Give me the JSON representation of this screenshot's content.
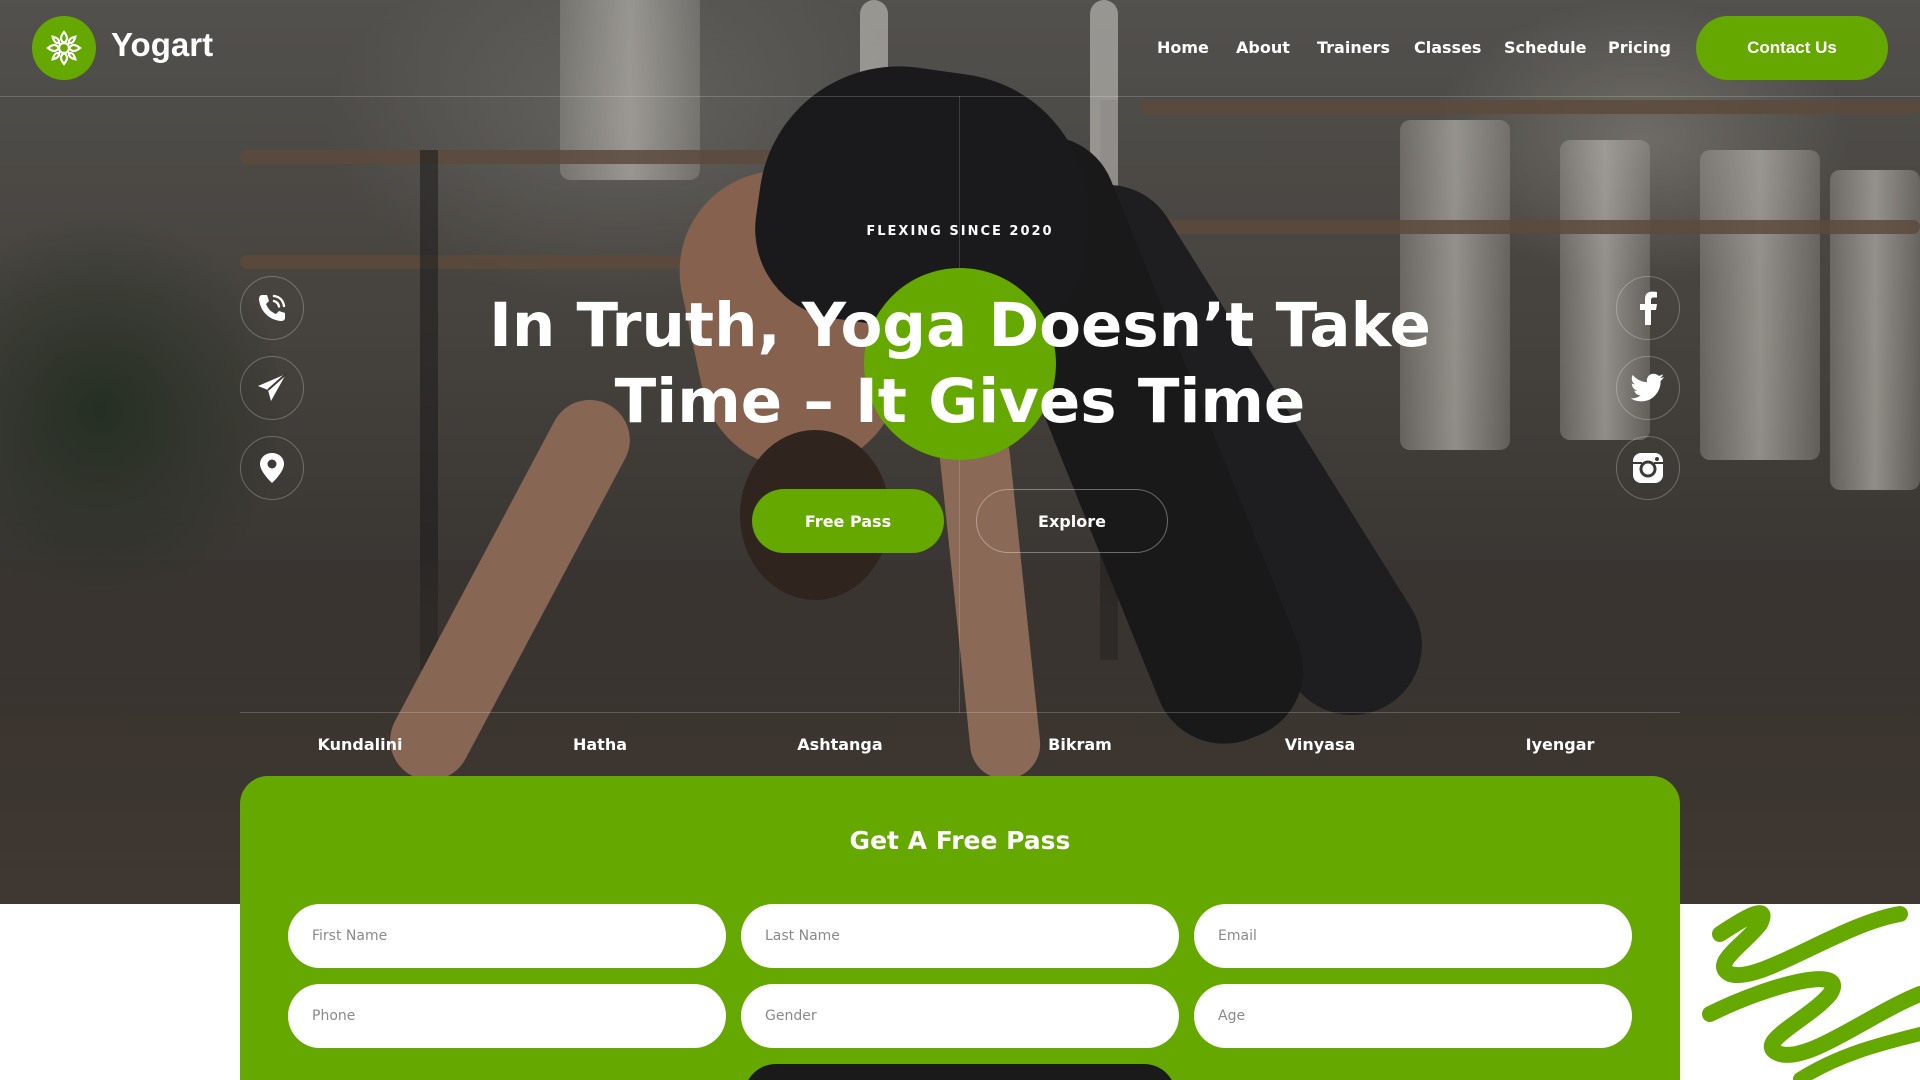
{
  "brand": {
    "name": "Yogart",
    "logo_icon": "lotus-icon",
    "accent_color": "#65a800"
  },
  "nav": {
    "items": [
      "Home",
      "About",
      "Trainers",
      "Classes",
      "Schedule",
      "Pricing"
    ],
    "contact_label": "Contact Us"
  },
  "hero": {
    "tagline": "FLEXING SINCE 2020",
    "headline_line1": "In Truth, Yoga Doesn’t Take",
    "headline_line2": "Time – It Gives Time",
    "primary_button": "Free Pass",
    "secondary_button": "Explore"
  },
  "contact_icons": [
    "phone-icon",
    "send-icon",
    "location-pin-icon"
  ],
  "social_icons": [
    "facebook-icon",
    "twitter-icon",
    "instagram-icon"
  ],
  "yoga_styles": [
    "Kundalini",
    "Hatha",
    "Ashtanga",
    "Bikram",
    "Vinyasa",
    "Iyengar"
  ],
  "form": {
    "title": "Get A Free Pass",
    "fields": {
      "first_name": "First Name",
      "last_name": "Last Name",
      "email": "Email",
      "phone": "Phone",
      "gender": "Gender",
      "age": "Age"
    }
  }
}
